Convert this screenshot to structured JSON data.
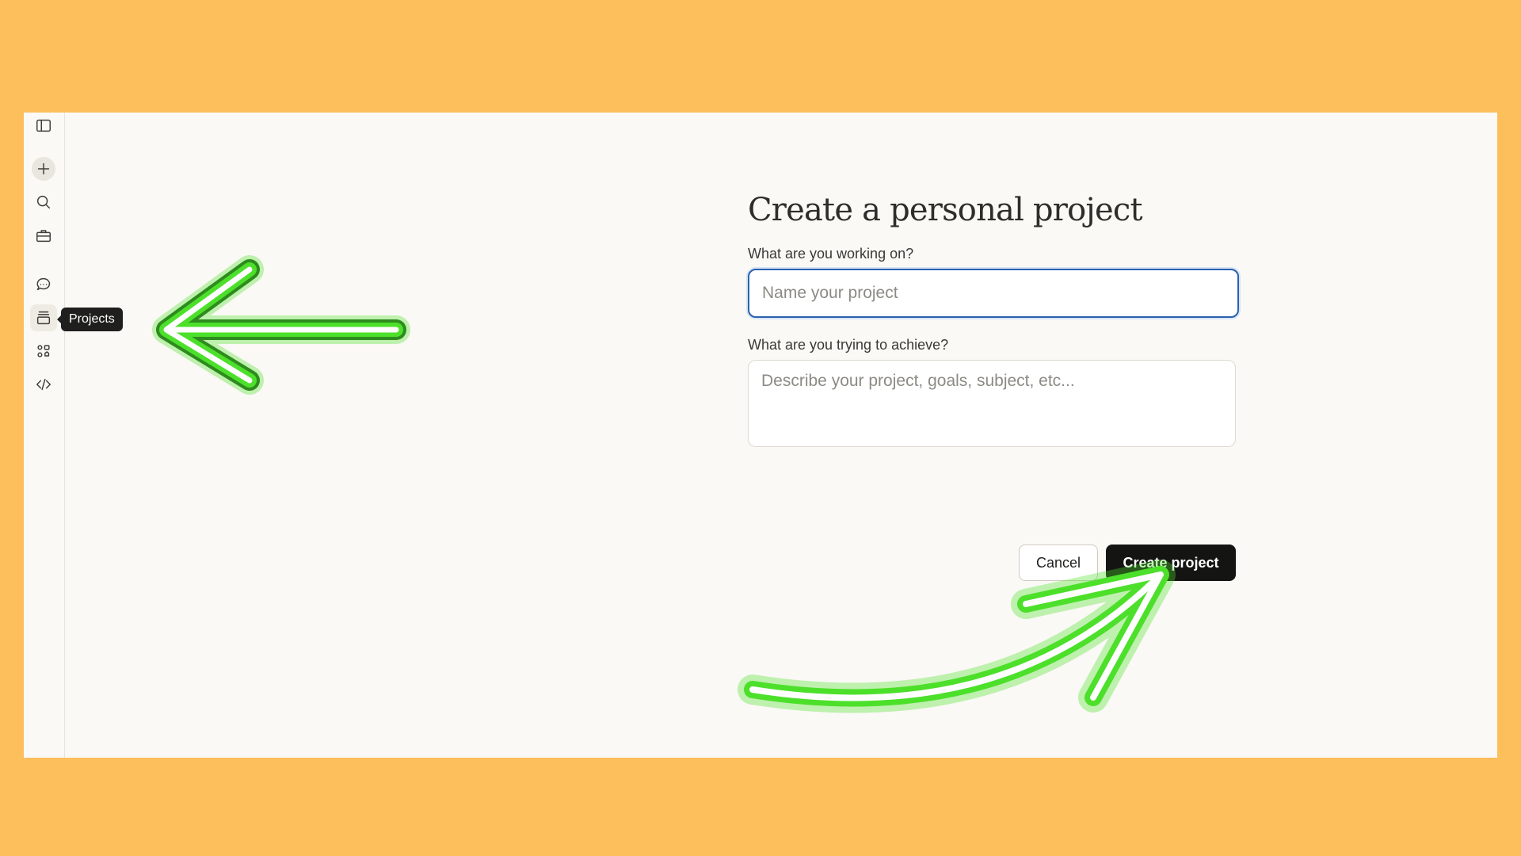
{
  "sidebar": {
    "items": [
      {
        "icon": "sidebar-toggle-icon"
      },
      {
        "icon": "plus-icon"
      },
      {
        "icon": "search-icon"
      },
      {
        "icon": "toolbox-icon"
      },
      {
        "icon": "chat-icon"
      },
      {
        "icon": "projects-icon"
      },
      {
        "icon": "artifacts-icon"
      },
      {
        "icon": "code-icon"
      }
    ],
    "tooltip": "Projects"
  },
  "form": {
    "title": "Create a personal project",
    "name_label": "What are you working on?",
    "name_placeholder": "Name your project",
    "goal_label": "What are you trying to achieve?",
    "goal_placeholder": "Describe your project, goals, subject, etc...",
    "cancel_label": "Cancel",
    "create_label": "Create project"
  },
  "colors": {
    "background": "#FDBE5C",
    "panel": "#FAF9F5",
    "annotation_arrow": "#4CE02A",
    "focus_border": "#2B61B0",
    "primary_button": "#141413"
  }
}
